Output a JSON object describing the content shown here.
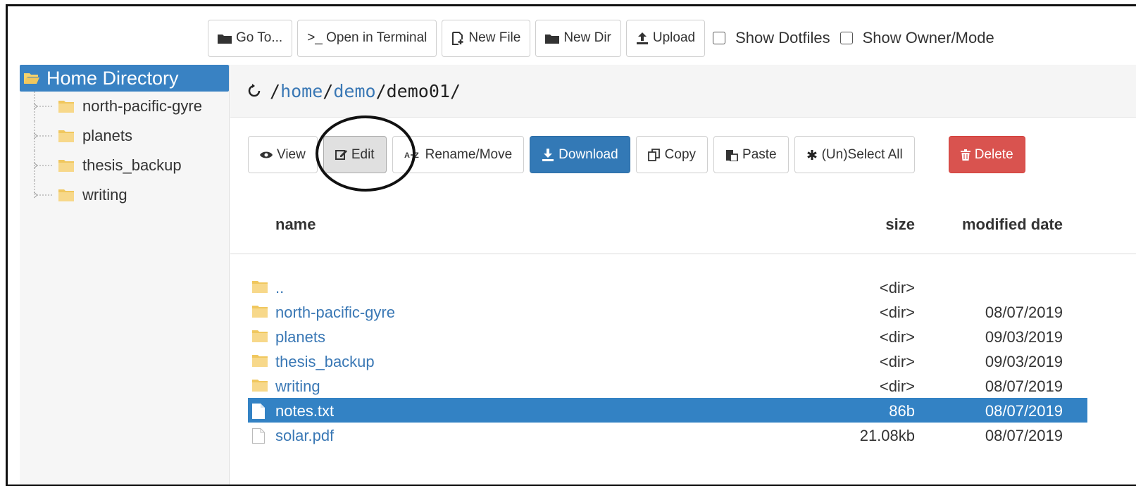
{
  "toolbar": {
    "goto_label": "Go To...",
    "terminal_label": ">_ Open in Terminal",
    "newfile_label": "New File",
    "newdir_label": "New Dir",
    "upload_label": "Upload",
    "show_dotfiles_label": "Show Dotfiles",
    "show_owner_label": "Show Owner/Mode",
    "show_dotfiles_checked": false,
    "show_owner_checked": false
  },
  "sidebar": {
    "root_label": "Home Directory",
    "items": [
      {
        "label": "north-pacific-gyre"
      },
      {
        "label": "planets"
      },
      {
        "label": "thesis_backup"
      },
      {
        "label": "writing"
      }
    ]
  },
  "path": {
    "seg1": "home",
    "seg2": "demo",
    "seg3": "demo01",
    "sep": "/"
  },
  "actions": {
    "view_label": "View",
    "edit_label": "Edit",
    "rename_label": "Rename/Move",
    "download_label": "Download",
    "copy_label": "Copy",
    "paste_label": "Paste",
    "select_all_label": "(Un)Select All",
    "delete_label": "Delete"
  },
  "table": {
    "headers": {
      "name": "name",
      "size": "size",
      "date": "modified date"
    },
    "rows": [
      {
        "name": "..",
        "size": "<dir>",
        "date": "",
        "type": "folder"
      },
      {
        "name": "north-pacific-gyre",
        "size": "<dir>",
        "date": "08/07/2019",
        "type": "folder"
      },
      {
        "name": "planets",
        "size": "<dir>",
        "date": "09/03/2019",
        "type": "folder"
      },
      {
        "name": "thesis_backup",
        "size": "<dir>",
        "date": "09/03/2019",
        "type": "folder"
      },
      {
        "name": "writing",
        "size": "<dir>",
        "date": "08/07/2019",
        "type": "folder"
      },
      {
        "name": "notes.txt",
        "size": "86b",
        "date": "08/07/2019",
        "type": "file",
        "selected": true
      },
      {
        "name": "solar.pdf",
        "size": "21.08kb",
        "date": "08/07/2019",
        "type": "file"
      }
    ]
  },
  "colors": {
    "accent": "#3382c4",
    "link": "#3a78b5",
    "danger": "#d9534f",
    "folder": "#f0c75e"
  }
}
